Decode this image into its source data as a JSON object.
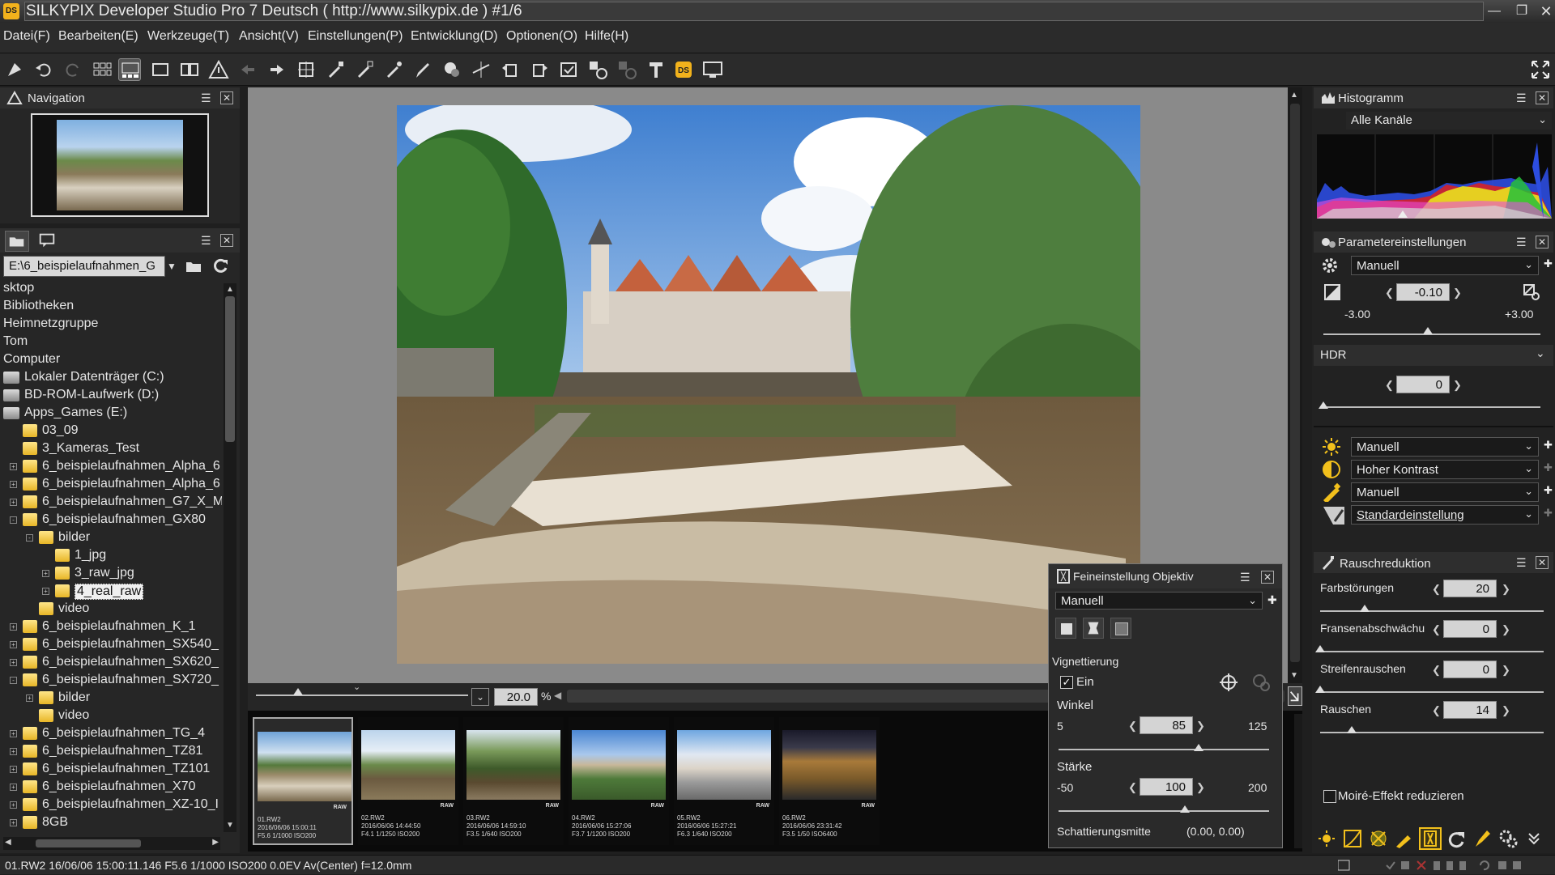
{
  "app": {
    "title": "SILKYPIX Developer Studio Pro 7 Deutsch ( http://www.silkypix.de )   #1/6",
    "logo": "DS"
  },
  "menu": [
    "Datei(F)",
    "Bearbeiten(E)",
    "Werkzeuge(T)",
    "Ansicht(V)",
    "Einstellungen(P)",
    "Entwicklung(D)",
    "Optionen(O)",
    "Hilfe(H)"
  ],
  "navigation": {
    "title": "Navigation"
  },
  "browser": {
    "path": "E:\\6_beispielaufnahmen_G",
    "tree": [
      {
        "label": "sktop",
        "indent": 0,
        "type": "text"
      },
      {
        "label": "Bibliotheken",
        "indent": 0,
        "type": "text"
      },
      {
        "label": "Heimnetzgruppe",
        "indent": 0,
        "type": "text"
      },
      {
        "label": "Tom",
        "indent": 0,
        "type": "text"
      },
      {
        "label": "Computer",
        "indent": 0,
        "type": "text"
      },
      {
        "label": "Lokaler Datenträger (C:)",
        "indent": 0,
        "type": "drive"
      },
      {
        "label": "BD-ROM-Laufwerk (D:)",
        "indent": 0,
        "type": "drive"
      },
      {
        "label": "Apps_Games (E:)",
        "indent": 0,
        "type": "drive"
      },
      {
        "label": "03_09",
        "indent": 1,
        "type": "folder",
        "exp": ""
      },
      {
        "label": "3_Kameras_Test",
        "indent": 1,
        "type": "folder",
        "exp": ""
      },
      {
        "label": "6_beispielaufnahmen_Alpha_6",
        "indent": 1,
        "type": "folder",
        "exp": "+"
      },
      {
        "label": "6_beispielaufnahmen_Alpha_6",
        "indent": 1,
        "type": "folder",
        "exp": "+"
      },
      {
        "label": "6_beispielaufnahmen_G7_X_M",
        "indent": 1,
        "type": "folder",
        "exp": "+"
      },
      {
        "label": "6_beispielaufnahmen_GX80",
        "indent": 1,
        "type": "folder",
        "exp": "-"
      },
      {
        "label": "bilder",
        "indent": 2,
        "type": "folder",
        "exp": "-"
      },
      {
        "label": "1_jpg",
        "indent": 3,
        "type": "folder",
        "exp": ""
      },
      {
        "label": "3_raw_jpg",
        "indent": 3,
        "type": "folder",
        "exp": "+"
      },
      {
        "label": "4_real_raw",
        "indent": 3,
        "type": "folder",
        "exp": "+",
        "selected": true
      },
      {
        "label": "video",
        "indent": 2,
        "type": "folder",
        "exp": ""
      },
      {
        "label": "6_beispielaufnahmen_K_1",
        "indent": 1,
        "type": "folder",
        "exp": "+"
      },
      {
        "label": "6_beispielaufnahmen_SX540_",
        "indent": 1,
        "type": "folder",
        "exp": "+"
      },
      {
        "label": "6_beispielaufnahmen_SX620_",
        "indent": 1,
        "type": "folder",
        "exp": "+"
      },
      {
        "label": "6_beispielaufnahmen_SX720_",
        "indent": 1,
        "type": "folder",
        "exp": "-"
      },
      {
        "label": "bilder",
        "indent": 2,
        "type": "folder",
        "exp": "+"
      },
      {
        "label": "video",
        "indent": 2,
        "type": "folder",
        "exp": ""
      },
      {
        "label": "6_beispielaufnahmen_TG_4",
        "indent": 1,
        "type": "folder",
        "exp": "+"
      },
      {
        "label": "6_beispielaufnahmen_TZ81",
        "indent": 1,
        "type": "folder",
        "exp": "+"
      },
      {
        "label": "6_beispielaufnahmen_TZ101",
        "indent": 1,
        "type": "folder",
        "exp": "+"
      },
      {
        "label": "6_beispielaufnahmen_X70",
        "indent": 1,
        "type": "folder",
        "exp": "+"
      },
      {
        "label": "6_beispielaufnahmen_XZ-10_I",
        "indent": 1,
        "type": "folder",
        "exp": "+"
      },
      {
        "label": "8GB",
        "indent": 1,
        "type": "folder",
        "exp": "+"
      }
    ]
  },
  "viewer": {
    "zoom": "20.0",
    "zoom_unit": "%"
  },
  "thumbnails": [
    {
      "name": "01.RW2",
      "date": "2016/06/06 15:00:11",
      "exif": "F5.6 1/1000 ISO200",
      "badge": "RAW",
      "selected": true
    },
    {
      "name": "02.RW2",
      "date": "2016/06/06 14:44:50",
      "exif": "F4.1 1/1250 ISO200",
      "badge": "RAW"
    },
    {
      "name": "03.RW2",
      "date": "2016/06/06 14:59:10",
      "exif": "F3.5 1/640 ISO200",
      "badge": "RAW"
    },
    {
      "name": "04.RW2",
      "date": "2016/06/06 15:27:06",
      "exif": "F3.7 1/1200 ISO200",
      "badge": "RAW"
    },
    {
      "name": "05.RW2",
      "date": "2016/06/06 15:27:21",
      "exif": "F6.3 1/640 ISO200",
      "badge": "RAW"
    },
    {
      "name": "06.RW2",
      "date": "2016/06/06 23:31:42",
      "exif": "F3.5 1/50 ISO6400",
      "badge": "RAW"
    }
  ],
  "histogram": {
    "title": "Histogramm",
    "channel": "Alle Kanäle"
  },
  "params": {
    "title": "Parametereinstellungen",
    "preset": "Manuell",
    "exposure": "-0.10",
    "exp_min": "-3.00",
    "exp_max": "+3.00",
    "exposure_level": 0.483,
    "hdr_label": "HDR",
    "hdr_value": "0",
    "hdr_level": 0,
    "wb": "Manuell",
    "tone": "Hoher Kontrast",
    "sharp": "Manuell",
    "style": "Standardeinstellung"
  },
  "noise": {
    "title": "Rauschreduktion",
    "rows": [
      {
        "label": "Farbstörungen",
        "value": "20",
        "level": 0.2
      },
      {
        "label": "Fransenabschwächu",
        "value": "0",
        "level": 0
      },
      {
        "label": "Streifenrauschen",
        "value": "0",
        "level": 0
      },
      {
        "label": "Rauschen",
        "value": "14",
        "level": 0.14
      }
    ],
    "moire": "Moiré-Effekt reduzieren"
  },
  "lens": {
    "title": "Feineinstellung Objektiv",
    "preset": "Manuell",
    "section": "Vignettierung",
    "enabled_label": "Ein",
    "angle_label": "Winkel",
    "angle_min": "5",
    "angle_max": "125",
    "angle": "85",
    "angle_level": 0.667,
    "strength_label": "Stärke",
    "strength_min": "-50",
    "strength_max": "200",
    "strength": "100",
    "strength_level": 0.6,
    "center_label": "Schattierungsmitte",
    "center_value": "(0.00, 0.00)"
  },
  "status": "01.RW2 16/06/06 15:00:11.146 F5.6 1/1000 ISO200  0.0EV Av(Center) f=12.0mm",
  "colors": {
    "accent_yellow": "#f2b21c",
    "bg": "#1f1f1f"
  }
}
